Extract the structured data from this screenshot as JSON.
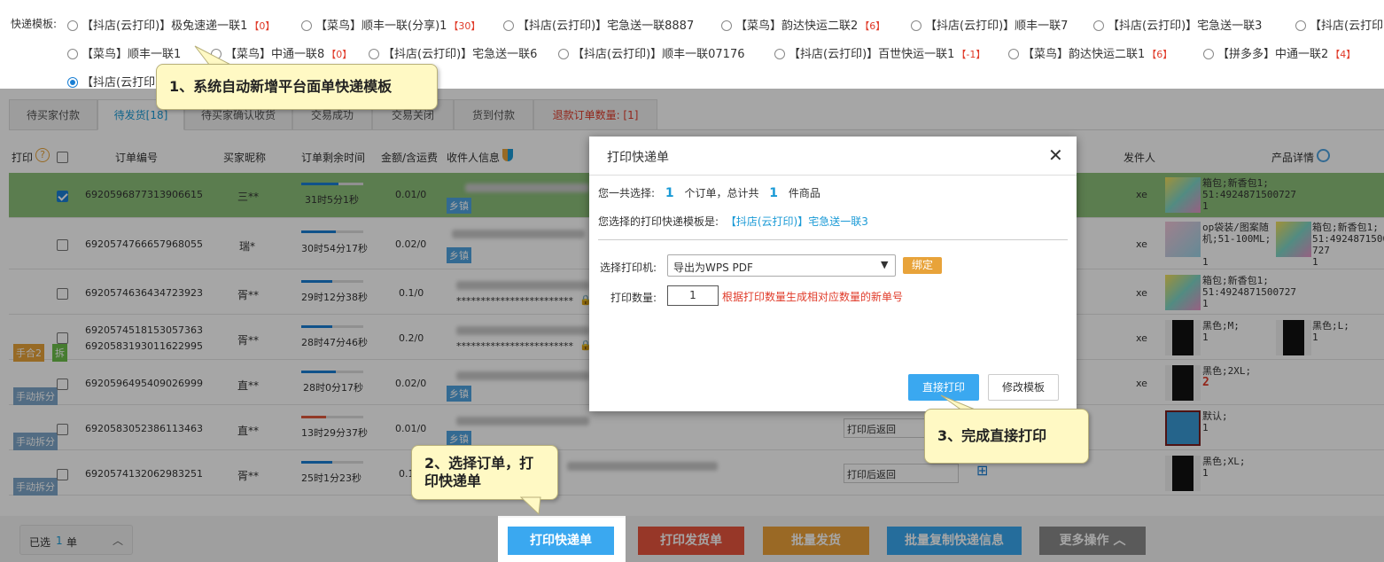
{
  "templates": {
    "label": "快递模板:",
    "row1": [
      {
        "name": "【抖店(云打印)】极兔速递一联1",
        "count": "【0】"
      },
      {
        "name": "【菜鸟】顺丰一联(分享)1",
        "count": "【30】"
      },
      {
        "name": "【抖店(云打印)】宅急送一联8887",
        "count": ""
      },
      {
        "name": "【菜鸟】韵达快运二联2",
        "count": "【6】"
      },
      {
        "name": "【抖店(云打印)】顺丰一联7",
        "count": ""
      },
      {
        "name": "【抖店(云打印)】宅急送一联3",
        "count": ""
      },
      {
        "name": "【抖店(云打印)",
        "count": ""
      }
    ],
    "row2": [
      {
        "name": "【菜鸟】顺丰一联1",
        "count": ""
      },
      {
        "name": "【菜鸟】中通一联8",
        "count": "【0】"
      },
      {
        "name": "【抖店(云打印)】宅急送一联6",
        "count": ""
      },
      {
        "name": "【抖店(云打印)】顺丰一联07176",
        "count": ""
      },
      {
        "name": "【抖店(云打印)】百世快运一联1",
        "count": "【-1】"
      },
      {
        "name": "【菜鸟】韵达快运二联1",
        "count": "【6】"
      },
      {
        "name": "【拼多多】中通一联2",
        "count": "【4】"
      }
    ],
    "row3": [
      {
        "name": "【抖店(云打印",
        "count": ""
      }
    ]
  },
  "tabs": [
    {
      "label": "待买家付款"
    },
    {
      "label": "待发货[18]"
    },
    {
      "label": "待买家确认收货"
    },
    {
      "label": "交易成功"
    },
    {
      "label": "交易关闭"
    },
    {
      "label": "货到付款"
    },
    {
      "label": "退款订单数量: [1]"
    }
  ],
  "table_headers": {
    "print": "打印",
    "order_no": "订单编号",
    "buyer": "买家昵称",
    "remain": "订单剩余时间",
    "amount": "金额/含运费",
    "receiver": "收件人信息",
    "sender": "发件人",
    "product": "产品详情"
  },
  "rows": [
    {
      "order": "6920596877313906615",
      "order2": "",
      "buyer": "三**",
      "time": "31时5分1秒",
      "progress": 0.6,
      "amount": "0.01/0",
      "town": "乡镇",
      "masked": "",
      "sender": "xe",
      "p1": [
        "箱包;新香包1;",
        "51:4924871500727",
        "1"
      ],
      "p2": []
    },
    {
      "order": "6920574766657968055",
      "order2": "",
      "buyer": "瑞*",
      "time": "30时54分17秒",
      "progress": 0.55,
      "amount": "0.02/0",
      "town": "乡镇",
      "masked": "",
      "sender": "xe",
      "p1": [
        "op袋装/图案随",
        "机;51-100ML;",
        "1"
      ],
      "p2": [
        "箱包;新香包1;",
        "51:4924871500",
        "727",
        "1"
      ]
    },
    {
      "order": "6920574636434723923",
      "order2": "",
      "buyer": "胥**",
      "time": "29时12分38秒",
      "progress": 0.5,
      "amount": "0.1/0",
      "town": "",
      "masked": "************************",
      "sender": "xe",
      "p1": [
        "箱包;新香包1;",
        "51:4924871500727",
        "1"
      ],
      "p2": []
    },
    {
      "order": "6920574518153057363",
      "order2": "6920583193011622995",
      "buyer": "胥**",
      "time": "28时47分46秒",
      "progress": 0.5,
      "amount": "0.2/0",
      "town": "",
      "masked": "************************",
      "sender": "xe",
      "p1": [
        "黑色;M;",
        "",
        "1"
      ],
      "p2": [
        "黑色;L;",
        "",
        "1"
      ]
    },
    {
      "order": "6920596495409026999",
      "order2": "",
      "buyer": "直**",
      "time": "28时0分17秒",
      "progress": 0.55,
      "amount": "0.02/0",
      "town": "乡镇",
      "masked": "",
      "sender": "xe",
      "p1": [
        "黑色;2XL;",
        "",
        "2"
      ],
      "p2": []
    },
    {
      "order": "6920583052386113463",
      "order2": "",
      "buyer": "直**",
      "time": "13时29分37秒",
      "progress": 0.4,
      "amount": "0.01/0",
      "town": "乡镇",
      "masked": "",
      "sender": "",
      "p1": [
        "默认;",
        "",
        "1"
      ],
      "p2": []
    },
    {
      "order": "6920574132062983251",
      "order2": "",
      "buyer": "胥**",
      "time": "25时1分23秒",
      "progress": 0.5,
      "amount": "0.1/0",
      "town": "",
      "masked": "**",
      "sender": "",
      "p1": [
        "黑色;XL;",
        "",
        "1"
      ],
      "p2": []
    }
  ],
  "row_tags": {
    "r4a": "手合2",
    "r4b": "拆",
    "manual": "手动拆分"
  },
  "return_label": "打印后返回",
  "callouts": {
    "c1": "1、系统自动新增平台面单快递模板",
    "c2": "2、选择订单，打印快递单",
    "c3": "3、完成直接打印"
  },
  "modal": {
    "title": "打印快递单",
    "sel_prefix": "您一共选择:",
    "orders_count": "1",
    "orders_text": "个订单，总计共",
    "items_count": "1",
    "items_text": "件商品",
    "tpl_prefix": "您选择的打印快递模板是:",
    "tpl_name": "【抖店(云打印)】宅急送一联3",
    "printer_label": "选择打印机:",
    "printer_value": "导出为WPS PDF",
    "bind_label": "绑定",
    "qty_label": "打印数量:",
    "qty_value": "1",
    "qty_hint": "根据打印数量生成相对应数量的新单号",
    "print_btn": "直接打印",
    "edit_btn": "修改模板"
  },
  "bottom": {
    "selected_prefix": "已选",
    "selected_count": "1",
    "selected_unit": "单",
    "btn_print_express": "打印快递单",
    "btn_print_invoice": "打印发货单",
    "btn_batch_ship": "批量发货",
    "btn_batch_copy": "批量复制快递信息",
    "btn_more": "更多操作"
  },
  "colors": {
    "accent_blue": "#1a9ad6",
    "red": "#e03b2a",
    "orange": "#e8a33a",
    "selected_row": "#8cc07a"
  }
}
